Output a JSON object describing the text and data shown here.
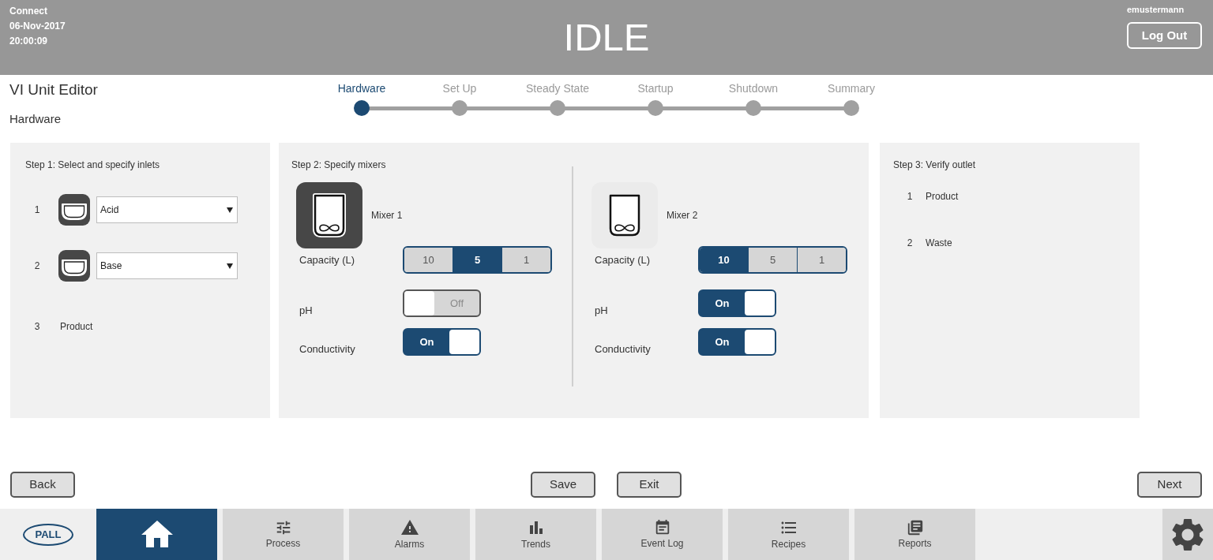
{
  "header": {
    "app_name": "Connect",
    "date": "06-Nov-2017",
    "time": "20:00:09",
    "status": "IDLE",
    "user": "emustermann",
    "logout_button": "Log Out"
  },
  "page": {
    "title": "VI Unit Editor",
    "subtitle": "Hardware"
  },
  "stepper": [
    {
      "label": "Hardware",
      "selected": true
    },
    {
      "label": "Set Up",
      "selected": false
    },
    {
      "label": "Steady State",
      "selected": false
    },
    {
      "label": "Startup",
      "selected": false
    },
    {
      "label": "Shutdown",
      "selected": false
    },
    {
      "label": "Summary",
      "selected": false
    }
  ],
  "inlets_panel": {
    "title": "Step 1: Select and specify inlets",
    "inlets": [
      {
        "number": "1",
        "kind": "select",
        "value": "Acid"
      },
      {
        "number": "2",
        "kind": "select",
        "value": "Base"
      },
      {
        "number": "3",
        "kind": "text",
        "value": "Product"
      }
    ]
  },
  "mixers_panel": {
    "title": "Step 2: Specify mixers",
    "mixers": [
      {
        "name": "Mixer 1",
        "selected": true,
        "capacity_label": "Capacity (L)",
        "capacity_options": [
          {
            "label": "10",
            "selected": false
          },
          {
            "label": "5",
            "selected": true
          },
          {
            "label": "1",
            "selected": false
          }
        ],
        "settings": [
          {
            "label": "pH",
            "on": false,
            "state_text": "Off"
          },
          {
            "label": "Conductivity",
            "on": true,
            "state_text": "On"
          }
        ]
      },
      {
        "name": "Mixer 2",
        "selected": false,
        "capacity_label": "Capacity (L)",
        "capacity_options": [
          {
            "label": "10",
            "selected": true
          },
          {
            "label": "5",
            "selected": false
          },
          {
            "label": "1",
            "selected": false
          }
        ],
        "settings": [
          {
            "label": "pH",
            "on": true,
            "state_text": "On"
          },
          {
            "label": "Conductivity",
            "on": true,
            "state_text": "On"
          }
        ]
      }
    ]
  },
  "outlet_panel": {
    "title": "Step 3: Verify outlet",
    "outlets": [
      {
        "number": "1",
        "name": "Product"
      },
      {
        "number": "2",
        "name": "Waste"
      }
    ]
  },
  "actions": {
    "back": "Back",
    "save": "Save",
    "exit": "Exit",
    "next": "Next"
  },
  "nav": {
    "logo": "PALL",
    "items": [
      {
        "kind": "home",
        "selected": true
      },
      {
        "kind": "process",
        "label": "Process",
        "selected": false
      },
      {
        "kind": "alarms",
        "label": "Alarms",
        "selected": false
      },
      {
        "kind": "trends",
        "label": "Trends",
        "selected": false
      },
      {
        "kind": "event_log",
        "label": "Event Log",
        "selected": false
      },
      {
        "kind": "recipes",
        "label": "Recipes",
        "selected": false
      },
      {
        "kind": "reports",
        "label": "Reports",
        "selected": false
      },
      {
        "kind": "settings",
        "selected": false
      }
    ]
  }
}
